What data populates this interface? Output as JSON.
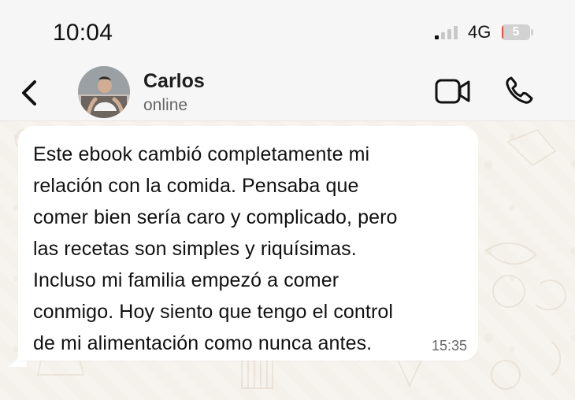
{
  "status_bar": {
    "time": "10:04",
    "network": "4G",
    "battery_level": "5",
    "battery_fraction": 0.05,
    "signal_icon": "signal-icon",
    "battery_color": "#e94a43"
  },
  "header": {
    "back_icon": "chevron-left-icon",
    "avatar_icon": "avatar",
    "contact_name": "Carlos",
    "contact_status": "online",
    "video_icon": "video-camera-icon",
    "call_icon": "phone-icon"
  },
  "message": {
    "text": "Este ebook cambió completamente mi\nrelación con la comida. Pensaba que\ncomer bien sería caro y complicado, pero\nlas recetas son simples y riquísimas.\nIncluso mi familia empezó a comer\nconmigo. Hoy siento que tengo el control\nde mi alimentación como nunca antes.",
    "time": "15:35"
  },
  "colors": {
    "bubble": "#ffffff",
    "wallpaper": "#f7f4ef",
    "header": "#f6f6f6",
    "text": "#111111",
    "muted": "#666666"
  }
}
